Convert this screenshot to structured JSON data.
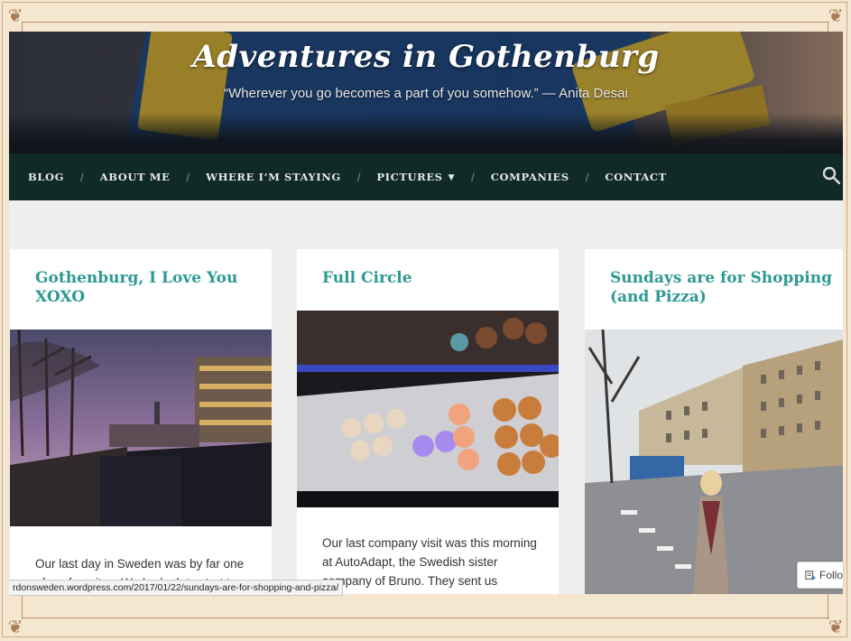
{
  "site": {
    "title": "Adventures in Gothenburg",
    "tagline": "“Wherever you go becomes a part of you somehow.” — Anita Desai"
  },
  "nav": {
    "items": [
      {
        "label": "BLOG"
      },
      {
        "label": "ABOUT ME"
      },
      {
        "label": "WHERE I’M STAYING"
      },
      {
        "label": "PICTURES"
      },
      {
        "label": "COMPANIES"
      },
      {
        "label": "CONTACT"
      }
    ],
    "separator": "/",
    "search_icon": "search-icon"
  },
  "posts": [
    {
      "title": "Gothenburg, I Love You XOXO",
      "image": "canal-at-dusk-photo",
      "excerpt": "Our last day in Sweden was by far one of my favorites. We had a late start to"
    },
    {
      "title": "Full Circle",
      "image": "donut-display-photo",
      "excerpt": "Our last company visit was this morning at AutoAdapt, the Swedish sister company of Bruno. They sent us"
    },
    {
      "title": "Sundays are for Shopping (and Pizza)",
      "image": "street-with-tram-photo",
      "excerpt": ""
    }
  ],
  "status_bar": {
    "url": "rdonsweden.wordpress.com/2017/01/22/sundays-are-for-shopping-and-pizza/"
  },
  "follow": {
    "label": "Follow",
    "visible_label": "Follo"
  },
  "colors": {
    "accent": "#2c9a93",
    "nav_bg": "#0f2a27",
    "page_bg": "#efefef",
    "frame_bg": "#f5e6cf"
  }
}
